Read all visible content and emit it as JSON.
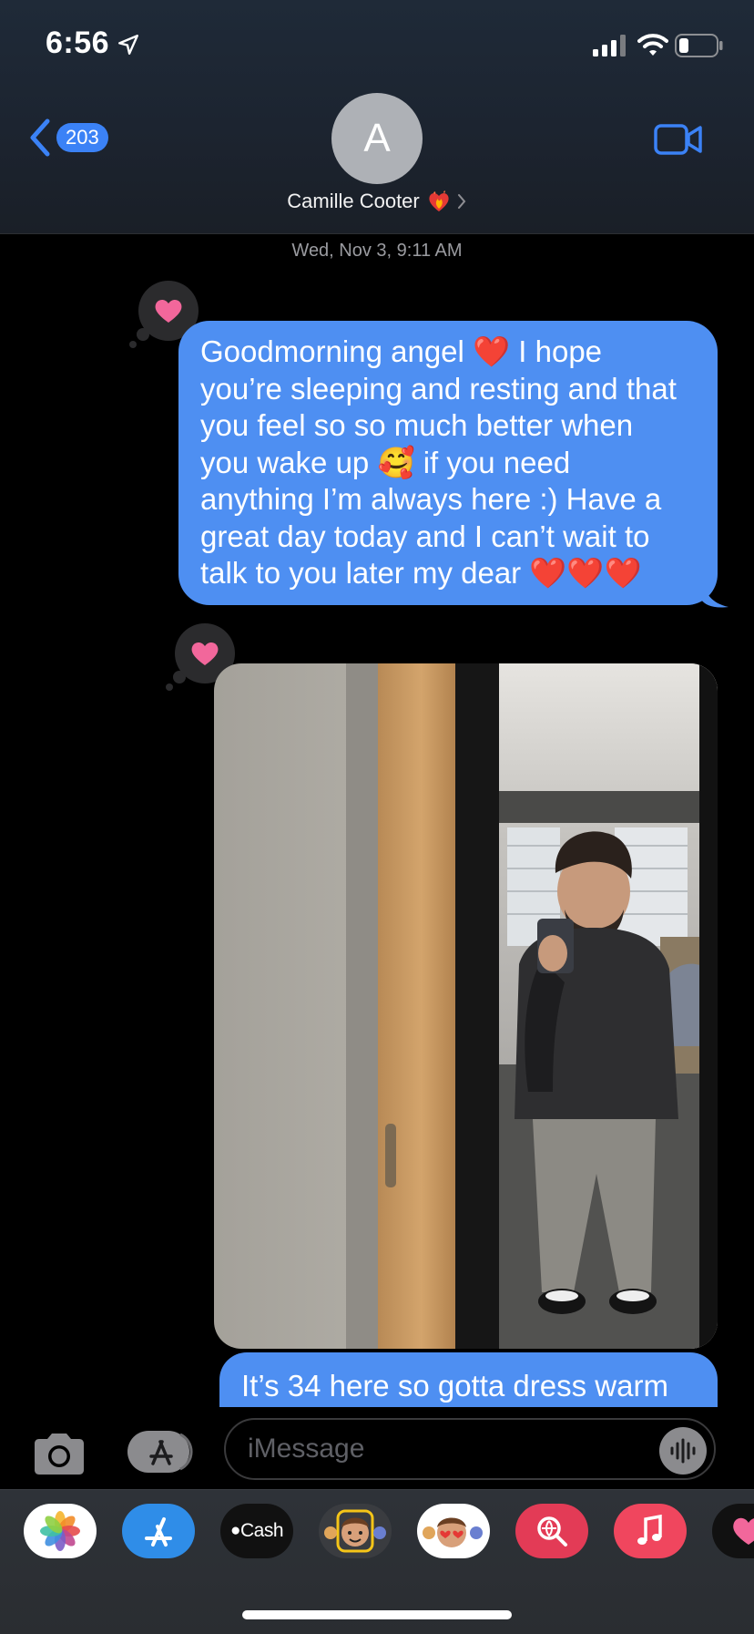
{
  "status_bar": {
    "time": "6:56",
    "icons": [
      "location-arrow-icon",
      "cellular-signal-icon",
      "wifi-icon",
      "battery-icon"
    ]
  },
  "header": {
    "back_count": "203",
    "avatar_initial": "A",
    "contact_name": "Camille Cooter",
    "icons": [
      "back-chevron-icon",
      "heart-fire-emoji-icon",
      "chevron-right-icon",
      "video-camera-icon"
    ]
  },
  "thread": {
    "timestamp": "Wed, Nov 3, 9:11 AM",
    "messages": [
      {
        "type": "text",
        "lines": [
          "Goodmorning angel ❤️ I hope",
          "you’re sleeping and resting and that",
          "you feel so so much better when",
          "you wake up 🥰 if you need",
          "anything I’m always here :) Have a",
          "great day today and I can’t wait to",
          "talk to you later my dear ❤️❤️❤️"
        ],
        "reaction": "heart-icon"
      },
      {
        "type": "image",
        "reaction": "heart-icon"
      },
      {
        "type": "text",
        "lines": [
          "It’s 34 here so gotta dress warm"
        ]
      }
    ]
  },
  "input_bar": {
    "placeholder": "iMessage",
    "icons": [
      "camera-icon",
      "app-store-icon",
      "audio-waveform-icon"
    ]
  },
  "app_drawer": {
    "apps": [
      {
        "name": "photos-app",
        "label": ""
      },
      {
        "name": "app-store-app",
        "label": ""
      },
      {
        "name": "apple-cash-app",
        "label": "Cash"
      },
      {
        "name": "memoji-app",
        "label": ""
      },
      {
        "name": "memoji-stickers-app",
        "label": ""
      },
      {
        "name": "images-search-app",
        "label": ""
      },
      {
        "name": "music-app",
        "label": ""
      },
      {
        "name": "digital-touch-app",
        "label": ""
      }
    ]
  },
  "colors": {
    "bubble_blue": "#4e8ff2",
    "link_blue": "#3b82f6",
    "tapback_heart": "#f2679b",
    "background": "#000000"
  }
}
